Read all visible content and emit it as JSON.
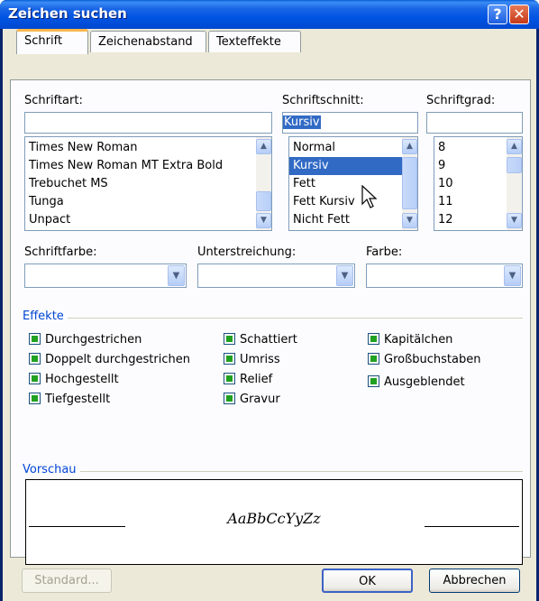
{
  "window": {
    "title": "Zeichen suchen",
    "help_symbol": "?",
    "close_symbol": "✕"
  },
  "tabs": [
    {
      "label": "Schrift",
      "active": true
    },
    {
      "label": "Zeichenabstand",
      "active": false
    },
    {
      "label": "Texteffekte",
      "active": false
    }
  ],
  "font": {
    "label": "Schriftart:",
    "value": "",
    "items": [
      "Times New Roman",
      "Times New Roman MT Extra Bold",
      "Trebuchet MS",
      "Tunga",
      "Unpact"
    ]
  },
  "style": {
    "label": "Schriftschnitt:",
    "value": "Kursiv",
    "items": [
      "Normal",
      "Kursiv",
      "Fett",
      "Fett Kursiv",
      "Nicht Fett"
    ],
    "selected": "Kursiv"
  },
  "size": {
    "label": "Schriftgrad:",
    "value": "",
    "items": [
      "8",
      "9",
      "10",
      "11",
      "12"
    ]
  },
  "font_color": {
    "label": "Schriftfarbe:",
    "value": ""
  },
  "underline": {
    "label": "Unterstreichung:",
    "value": ""
  },
  "color": {
    "label": "Farbe:",
    "value": ""
  },
  "effects": {
    "title": "Effekte",
    "col1": [
      "Durchgestrichen",
      "Doppelt durchgestrichen",
      "Hochgestellt",
      "Tiefgestellt"
    ],
    "col2": [
      "Schattiert",
      "Umriss",
      "Relief",
      "Gravur"
    ],
    "col3": [
      "Kapitälchen",
      "Großbuchstaben",
      "Ausgeblendet"
    ]
  },
  "preview": {
    "title": "Vorschau",
    "sample": "AaBbCcYyZz"
  },
  "buttons": {
    "standard": "Standard...",
    "ok": "OK",
    "cancel": "Abbrechen"
  },
  "colors": {
    "accent": "#316ac5",
    "check_fill": "#21a121",
    "group_title": "#0046d5",
    "title_bar": "#0054e3"
  },
  "icons": {
    "scroll_up": "▲",
    "scroll_down": "▼",
    "dropdown": "▼"
  }
}
